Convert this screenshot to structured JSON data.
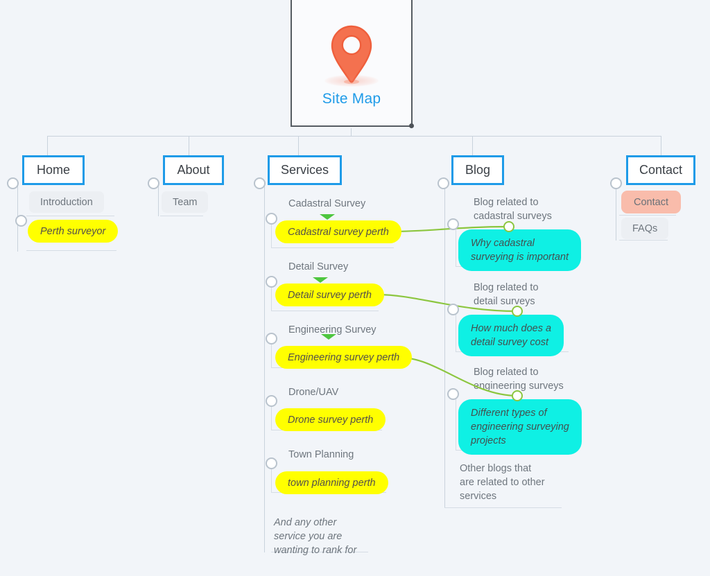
{
  "root": {
    "title": "Site Map",
    "icon": "map-pin-icon",
    "accent_color": "#1e9be8",
    "pin_color": "#f4714f"
  },
  "colors": {
    "background": "#f2f5f9",
    "node_border": "#1e9be8",
    "keyword_pill": "#ffff00",
    "blog_pill": "#0ff0e4",
    "contact_pill": "#f9bcab",
    "plain_pill": "#eceff3",
    "connector": "#c9d2dc",
    "green_link": "#8cc63f"
  },
  "sections": [
    {
      "id": "home",
      "label": "Home",
      "children": [
        {
          "type": "plain",
          "label": "Introduction"
        },
        {
          "type": "keyword",
          "label": "Perth surveyor"
        }
      ]
    },
    {
      "id": "about",
      "label": "About",
      "children": [
        {
          "type": "plain",
          "label": "Team"
        }
      ]
    },
    {
      "id": "services",
      "label": "Services",
      "groups": [
        {
          "label": "Cadastral Survey",
          "keyword": "Cadastral survey perth",
          "marker": true
        },
        {
          "label": "Detail Survey",
          "keyword": "Detail survey perth",
          "marker": true
        },
        {
          "label": "Engineering Survey",
          "keyword": "Engineering survey perth",
          "marker": true
        },
        {
          "label": "Drone/UAV",
          "keyword": "Drone survey perth",
          "marker": false
        },
        {
          "label": "Town Planning",
          "keyword": "town planning perth",
          "marker": false
        }
      ],
      "note": "And any other\nservice you are\nwanting to rank for"
    },
    {
      "id": "blog",
      "label": "Blog",
      "groups": [
        {
          "label": "Blog related to\ncadastral surveys",
          "article": "Why cadastral\nsurveying is important"
        },
        {
          "label": "Blog related to\ndetail surveys",
          "article": "How much does a\ndetail survey cost"
        },
        {
          "label": "Blog related to\nengineering surveys",
          "article": "Different types of\nengineering surveying\nprojects"
        }
      ],
      "note": "Other blogs that\nare related to other\nservices"
    },
    {
      "id": "contact",
      "label": "Contact",
      "children": [
        {
          "type": "contact",
          "label": "Contact"
        },
        {
          "type": "plain",
          "label": "FAQs"
        }
      ]
    }
  ],
  "links": [
    {
      "from": "Cadastral survey perth",
      "to": "Why cadastral surveying is important"
    },
    {
      "from": "Detail survey perth",
      "to": "How much does a detail survey cost"
    },
    {
      "from": "Engineering survey perth",
      "to": "Different types of engineering surveying projects"
    }
  ]
}
